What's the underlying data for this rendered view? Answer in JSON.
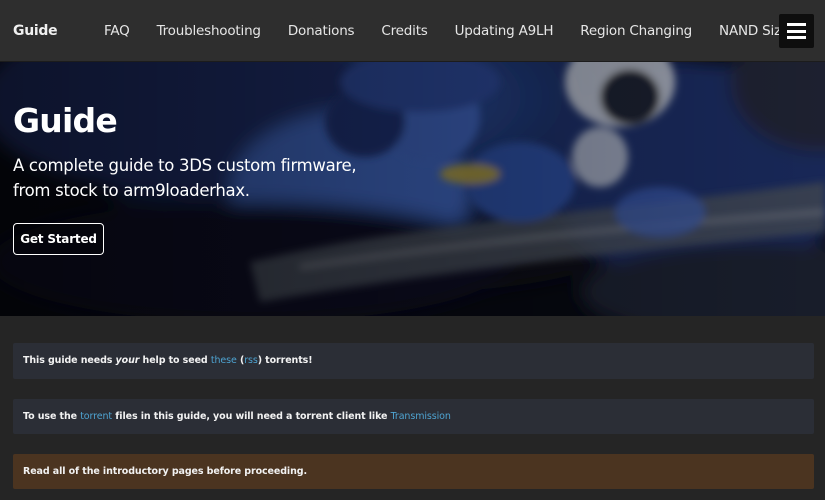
{
  "header": {
    "site_title": "Guide",
    "nav": [
      {
        "label": "FAQ"
      },
      {
        "label": "Troubleshooting"
      },
      {
        "label": "Donations"
      },
      {
        "label": "Credits"
      },
      {
        "label": "Updating A9LH"
      },
      {
        "label": "Region Changing"
      },
      {
        "label": "NAND Size"
      }
    ],
    "menu_icon": "hamburger-menu-icon"
  },
  "hero": {
    "title": "Guide",
    "tagline_line1": "A complete guide to 3DS custom firmware,",
    "tagline_line2": "from stock to arm9loaderhax.",
    "button_label": "Get Started"
  },
  "notices": [
    {
      "type": "info",
      "text_before": "This guide needs ",
      "text_emph": "your",
      "text_mid": " help to seed ",
      "link1": "these",
      "paren_open": " (",
      "link2": "rss",
      "paren_close": ")",
      "text_after": " torrents!"
    },
    {
      "type": "info",
      "text_before": "To use the ",
      "link1": "torrent",
      "text_mid": " files in this guide, you will need a torrent client like ",
      "link2": "Transmission"
    },
    {
      "type": "warning",
      "text": "Read all of the introductory pages before proceeding."
    }
  ],
  "colors": {
    "background": "#252525",
    "topbar": "#2e2e2e",
    "link": "#4ea3d1",
    "info_notice": "#2b2e36",
    "warning_notice": "#4b3420"
  }
}
